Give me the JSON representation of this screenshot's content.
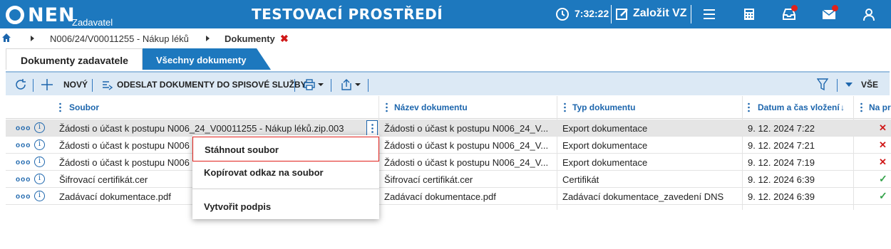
{
  "header": {
    "logo_text": "NEN",
    "logo_sub": "Zadavatel",
    "env_title": "TESTOVACÍ PROSTŘEDÍ",
    "time": "7:32:22",
    "new_vz_label": "Založit VZ",
    "accent": "#1d78be"
  },
  "breadcrumb": {
    "item1": "N006/24/V00011255 - Nákup léků",
    "item2": "Dokumenty"
  },
  "tabs": {
    "tab1": "Dokumenty zadavatele",
    "tab2": "Všechny dokumenty"
  },
  "toolbar": {
    "new_label": "NOVÝ",
    "send_label": "ODESLAT DOKUMENTY DO SPISOVÉ SLUŽBY",
    "filter_label": "VŠE"
  },
  "table": {
    "headers": {
      "soubor": "Soubor",
      "nazev": "Název dokumentu",
      "typ": "Typ dokumentu",
      "datum": "Datum a čas vložení",
      "sort": "↓",
      "na": "Na pr"
    },
    "rows": [
      {
        "soubor": "Žádosti o účast k postupu N006_24_V00011255 - Nákup léků.zip.003",
        "nazev": "Žádosti o účast k postupu N006_24_V...",
        "typ": "Export dokumentace",
        "datum": "9. 12. 2024 7:22",
        "status": "✕"
      },
      {
        "soubor": "Žádosti o účast k postupu N006",
        "nazev": "Žádosti o účast k postupu N006_24_V...",
        "typ": "Export dokumentace",
        "datum": "9. 12. 2024 7:21",
        "status": "✕"
      },
      {
        "soubor": "Žádosti o účast k postupu N006",
        "nazev": "Žádosti o účast k postupu N006_24_V...",
        "typ": "Export dokumentace",
        "datum": "9. 12. 2024 7:19",
        "status": "✕"
      },
      {
        "soubor": "Šifrovací certifikát.cer",
        "nazev": "Šifrovací certifikát.cer",
        "typ": "Certifikát",
        "datum": "9. 12. 2024 6:39",
        "status": "✓"
      },
      {
        "soubor": "Zadávací dokumentace.pdf",
        "nazev": "Zadávací dokumentace.pdf",
        "typ": "Zadávací dokumentace_zavedení DNS",
        "datum": "9. 12. 2024 6:39",
        "status": "✓"
      }
    ]
  },
  "context_menu": {
    "download": "Stáhnout soubor",
    "copy_link": "Kopírovat odkaz na soubor",
    "sign": "Vytvořit podpis"
  }
}
